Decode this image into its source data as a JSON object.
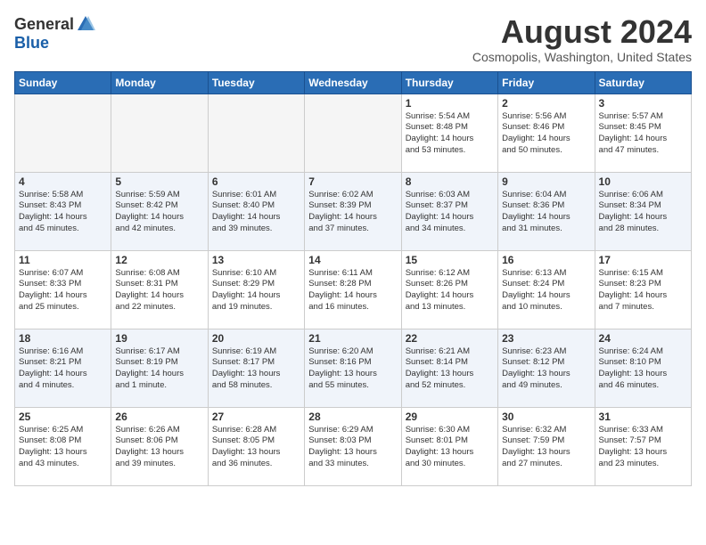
{
  "logo": {
    "general": "General",
    "blue": "Blue"
  },
  "title": "August 2024",
  "location": "Cosmopolis, Washington, United States",
  "days_of_week": [
    "Sunday",
    "Monday",
    "Tuesday",
    "Wednesday",
    "Thursday",
    "Friday",
    "Saturday"
  ],
  "weeks": [
    [
      {
        "day": "",
        "info": ""
      },
      {
        "day": "",
        "info": ""
      },
      {
        "day": "",
        "info": ""
      },
      {
        "day": "",
        "info": ""
      },
      {
        "day": "1",
        "info": "Sunrise: 5:54 AM\nSunset: 8:48 PM\nDaylight: 14 hours\nand 53 minutes."
      },
      {
        "day": "2",
        "info": "Sunrise: 5:56 AM\nSunset: 8:46 PM\nDaylight: 14 hours\nand 50 minutes."
      },
      {
        "day": "3",
        "info": "Sunrise: 5:57 AM\nSunset: 8:45 PM\nDaylight: 14 hours\nand 47 minutes."
      }
    ],
    [
      {
        "day": "4",
        "info": "Sunrise: 5:58 AM\nSunset: 8:43 PM\nDaylight: 14 hours\nand 45 minutes."
      },
      {
        "day": "5",
        "info": "Sunrise: 5:59 AM\nSunset: 8:42 PM\nDaylight: 14 hours\nand 42 minutes."
      },
      {
        "day": "6",
        "info": "Sunrise: 6:01 AM\nSunset: 8:40 PM\nDaylight: 14 hours\nand 39 minutes."
      },
      {
        "day": "7",
        "info": "Sunrise: 6:02 AM\nSunset: 8:39 PM\nDaylight: 14 hours\nand 37 minutes."
      },
      {
        "day": "8",
        "info": "Sunrise: 6:03 AM\nSunset: 8:37 PM\nDaylight: 14 hours\nand 34 minutes."
      },
      {
        "day": "9",
        "info": "Sunrise: 6:04 AM\nSunset: 8:36 PM\nDaylight: 14 hours\nand 31 minutes."
      },
      {
        "day": "10",
        "info": "Sunrise: 6:06 AM\nSunset: 8:34 PM\nDaylight: 14 hours\nand 28 minutes."
      }
    ],
    [
      {
        "day": "11",
        "info": "Sunrise: 6:07 AM\nSunset: 8:33 PM\nDaylight: 14 hours\nand 25 minutes."
      },
      {
        "day": "12",
        "info": "Sunrise: 6:08 AM\nSunset: 8:31 PM\nDaylight: 14 hours\nand 22 minutes."
      },
      {
        "day": "13",
        "info": "Sunrise: 6:10 AM\nSunset: 8:29 PM\nDaylight: 14 hours\nand 19 minutes."
      },
      {
        "day": "14",
        "info": "Sunrise: 6:11 AM\nSunset: 8:28 PM\nDaylight: 14 hours\nand 16 minutes."
      },
      {
        "day": "15",
        "info": "Sunrise: 6:12 AM\nSunset: 8:26 PM\nDaylight: 14 hours\nand 13 minutes."
      },
      {
        "day": "16",
        "info": "Sunrise: 6:13 AM\nSunset: 8:24 PM\nDaylight: 14 hours\nand 10 minutes."
      },
      {
        "day": "17",
        "info": "Sunrise: 6:15 AM\nSunset: 8:23 PM\nDaylight: 14 hours\nand 7 minutes."
      }
    ],
    [
      {
        "day": "18",
        "info": "Sunrise: 6:16 AM\nSunset: 8:21 PM\nDaylight: 14 hours\nand 4 minutes."
      },
      {
        "day": "19",
        "info": "Sunrise: 6:17 AM\nSunset: 8:19 PM\nDaylight: 14 hours\nand 1 minute."
      },
      {
        "day": "20",
        "info": "Sunrise: 6:19 AM\nSunset: 8:17 PM\nDaylight: 13 hours\nand 58 minutes."
      },
      {
        "day": "21",
        "info": "Sunrise: 6:20 AM\nSunset: 8:16 PM\nDaylight: 13 hours\nand 55 minutes."
      },
      {
        "day": "22",
        "info": "Sunrise: 6:21 AM\nSunset: 8:14 PM\nDaylight: 13 hours\nand 52 minutes."
      },
      {
        "day": "23",
        "info": "Sunrise: 6:23 AM\nSunset: 8:12 PM\nDaylight: 13 hours\nand 49 minutes."
      },
      {
        "day": "24",
        "info": "Sunrise: 6:24 AM\nSunset: 8:10 PM\nDaylight: 13 hours\nand 46 minutes."
      }
    ],
    [
      {
        "day": "25",
        "info": "Sunrise: 6:25 AM\nSunset: 8:08 PM\nDaylight: 13 hours\nand 43 minutes."
      },
      {
        "day": "26",
        "info": "Sunrise: 6:26 AM\nSunset: 8:06 PM\nDaylight: 13 hours\nand 39 minutes."
      },
      {
        "day": "27",
        "info": "Sunrise: 6:28 AM\nSunset: 8:05 PM\nDaylight: 13 hours\nand 36 minutes."
      },
      {
        "day": "28",
        "info": "Sunrise: 6:29 AM\nSunset: 8:03 PM\nDaylight: 13 hours\nand 33 minutes."
      },
      {
        "day": "29",
        "info": "Sunrise: 6:30 AM\nSunset: 8:01 PM\nDaylight: 13 hours\nand 30 minutes."
      },
      {
        "day": "30",
        "info": "Sunrise: 6:32 AM\nSunset: 7:59 PM\nDaylight: 13 hours\nand 27 minutes."
      },
      {
        "day": "31",
        "info": "Sunrise: 6:33 AM\nSunset: 7:57 PM\nDaylight: 13 hours\nand 23 minutes."
      }
    ]
  ]
}
